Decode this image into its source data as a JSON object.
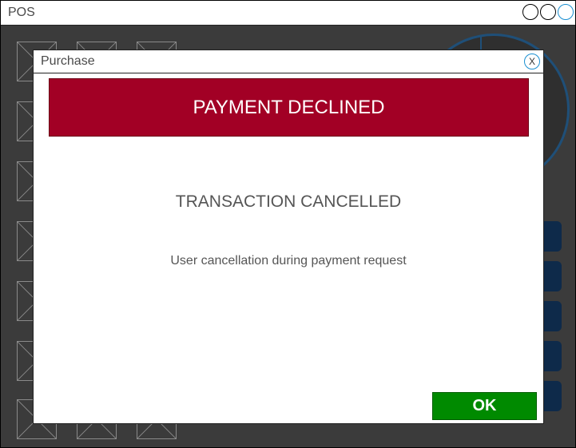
{
  "window": {
    "title": "POS",
    "controls": [
      "minimize-button",
      "maximize-button",
      "close-window-button"
    ]
  },
  "dialog": {
    "title": "Purchase",
    "close_label": "X",
    "banner": "PAYMENT DECLINED",
    "status": "TRANSACTION CANCELLED",
    "detail": "User cancellation during payment request",
    "ok_label": "OK"
  },
  "colors": {
    "declined": "#a20025",
    "ok": "#008a00",
    "accent": "#1a8fd1",
    "background": "#3b3b3b"
  }
}
